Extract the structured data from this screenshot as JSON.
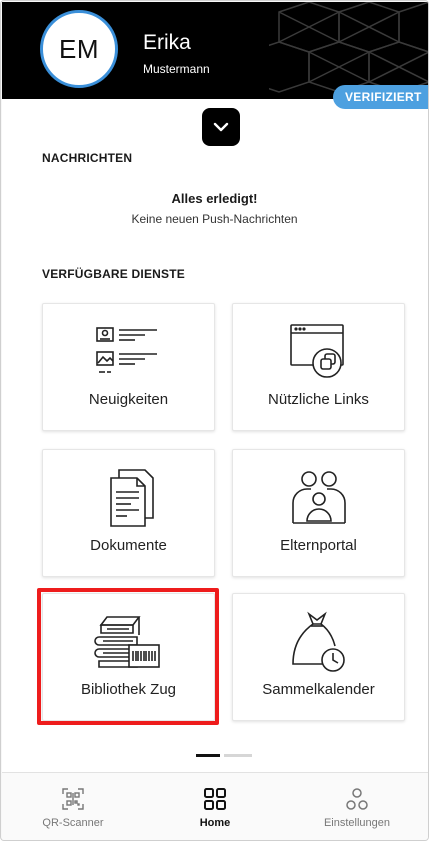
{
  "user": {
    "initials": "EM",
    "first_name": "Erika",
    "last_name": "Mustermann",
    "status_badge": "VERIFIZIERT"
  },
  "messages": {
    "section_title": "NACHRICHTEN",
    "title": "Alles erledigt!",
    "subtitle": "Keine neuen Push-Nachrichten"
  },
  "services": {
    "section_title": "VERFÜGBARE DIENSTE",
    "items": [
      {
        "label": "Neuigkeiten",
        "icon": "news-icon"
      },
      {
        "label": "Nützliche Links",
        "icon": "links-icon"
      },
      {
        "label": "Dokumente",
        "icon": "documents-icon"
      },
      {
        "label": "Elternportal",
        "icon": "parents-portal-icon"
      },
      {
        "label": "Bibliothek Zug",
        "icon": "library-icon"
      },
      {
        "label": "Sammelkalender",
        "icon": "waste-calendar-icon"
      }
    ],
    "highlighted_item": "Bibliothek Zug"
  },
  "pager": {
    "pages": 2,
    "current": 1
  },
  "tabbar": {
    "tabs": [
      {
        "label": "QR-Scanner",
        "icon": "qr-scanner-icon",
        "active": false
      },
      {
        "label": "Home",
        "icon": "home-grid-icon",
        "active": true
      },
      {
        "label": "Einstellungen",
        "icon": "settings-icon",
        "active": false
      }
    ]
  },
  "colors": {
    "header_bg": "#000000",
    "accent": "#4da0e0",
    "avatar_ring": "#3a8fd9",
    "highlight": "#ee1c1c"
  }
}
